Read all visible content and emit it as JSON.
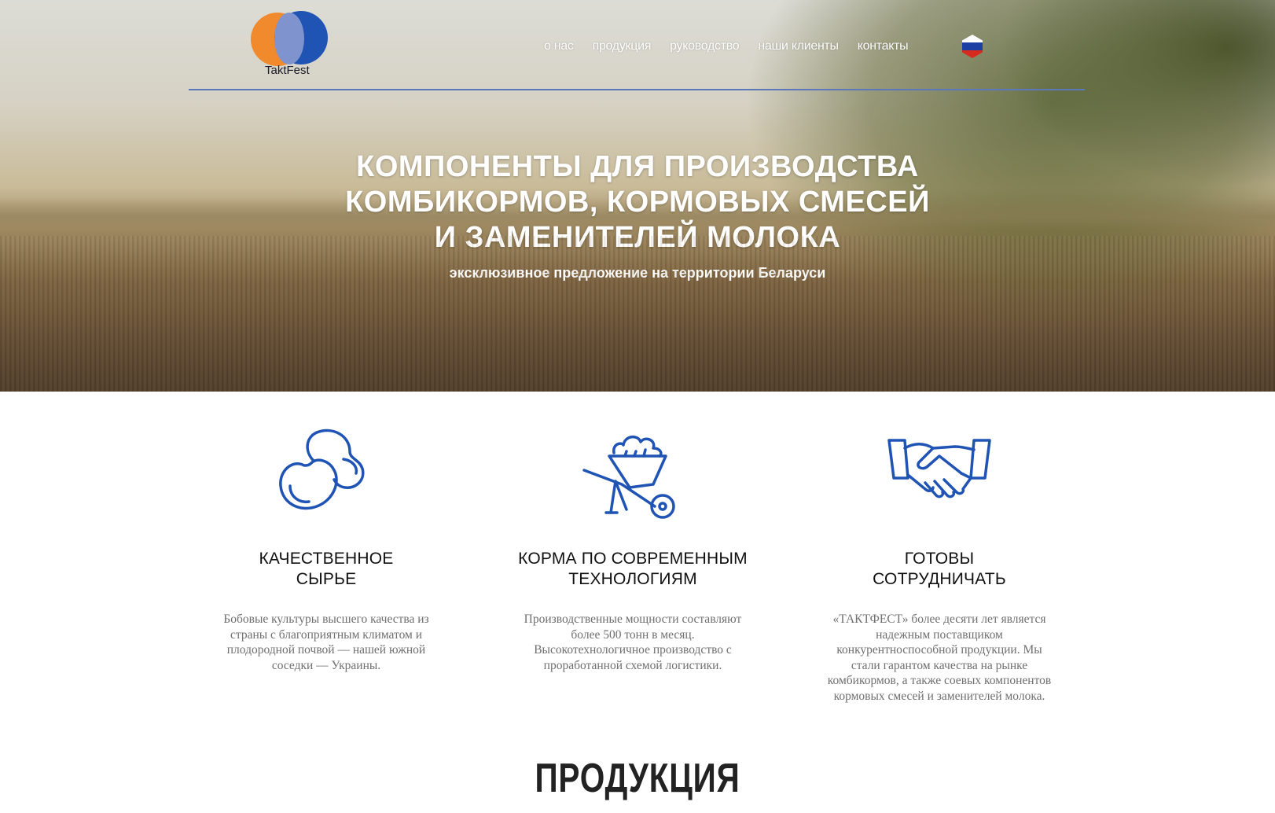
{
  "brand": {
    "logo_text": "TaktFest"
  },
  "nav": {
    "items": [
      {
        "label": "о нас"
      },
      {
        "label": "продукция"
      },
      {
        "label": "руководство"
      },
      {
        "label": "наши клиенты"
      },
      {
        "label": "контакты"
      }
    ],
    "language": "ru-flag-icon"
  },
  "hero": {
    "headline_1": "КОМПОНЕНТЫ ДЛЯ ПРОИЗВОДСТВА",
    "headline_2": "КОМБИКОРМОВ, КОРМОВЫХ СМЕСЕЙ",
    "headline_3": "И ЗАМЕНИТЕЛЕЙ МОЛОКА",
    "subtitle": "эксклюзивное предложение на территории Беларуси"
  },
  "features": [
    {
      "icon": "beans-icon",
      "title_1": "КАЧЕСТВЕННОЕ",
      "title_2": "СЫРЬЕ",
      "text": "Бобовые культуры высшего качества из страны с благоприятным климатом и плодородной почвой — нашей южной соседки — Украины."
    },
    {
      "icon": "wheelbarrow-icon",
      "title_1": "КОРМА ПО СОВРЕМЕННЫМ",
      "title_2": "ТЕХНОЛОГИЯМ",
      "text": "Производственные мощности составляют более 500 тонн в месяц. Высокотехнологичное производство с проработанной схемой логистики."
    },
    {
      "icon": "handshake-icon",
      "title_1": "ГОТОВЫ",
      "title_2": "СОТРУДНИЧАТЬ",
      "text": "«ТАКТФЕСТ» более десяти лет является надежным поставщиком конкурентноспособной продукции. Мы стали гарантом качества на рынке комбикормов, а также соевых компонентов кормовых смесей и заменителей молока."
    }
  ],
  "products_section": {
    "title": "ПРОДУКЦИЯ"
  },
  "colors": {
    "accent": "#1f53b4",
    "logo_orange": "#f08a2c",
    "icon_blue": "#1f53b4"
  }
}
